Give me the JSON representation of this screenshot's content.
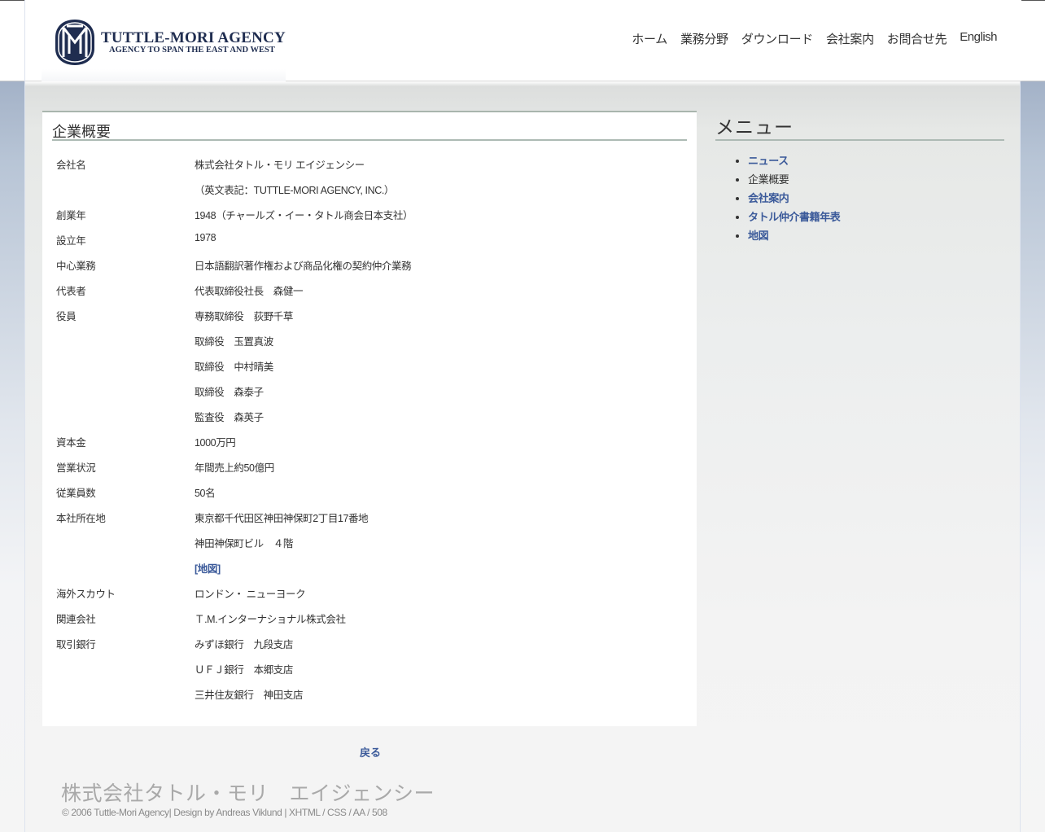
{
  "header": {
    "logo_title": "TUTTLE-MORI AGENCY",
    "logo_subtitle": "AGENCY TO SPAN THE EAST AND WEST",
    "nav": [
      "ホーム",
      "業務分野",
      "ダウンロード",
      "会社案内",
      "お問合せ先",
      "English"
    ]
  },
  "main": {
    "section_title": "企業概要",
    "rows": [
      {
        "key": "会社名",
        "value": "株式会社タトル・モリ エイジェンシー"
      },
      {
        "key": "",
        "value": "（英文表記：TUTTLE-MORI AGENCY, INC.）"
      },
      {
        "key": "創業年",
        "value": "1948（チャールズ・イー・タトル商会日本支社）"
      },
      {
        "key": "設立年",
        "value": "1978"
      },
      {
        "key": "中心業務",
        "value": "日本語翻訳著作権および商品化権の契約仲介業務"
      },
      {
        "key": "代表者",
        "value": "代表取締役社長　森健一"
      },
      {
        "key": "役員",
        "value": "専務取締役　荻野千草"
      },
      {
        "key": "",
        "value": "取締役　玉置真波"
      },
      {
        "key": "",
        "value": "取締役　中村晴美"
      },
      {
        "key": "",
        "value": "取締役　森泰子"
      },
      {
        "key": "",
        "value": "監査役　森英子"
      },
      {
        "key": "資本金",
        "value": "1000万円"
      },
      {
        "key": "営業状況",
        "value": "年間売上約50億円"
      },
      {
        "key": "従業員数",
        "value": "50名"
      },
      {
        "key": "本社所在地",
        "value": "東京都千代田区神田神保町2丁目17番地"
      },
      {
        "key": "",
        "value": "神田神保町ビル　４階"
      },
      {
        "key": "",
        "value": "[地図]",
        "link": true
      },
      {
        "key": "海外スカウト",
        "value": "ロンドン・ ニューヨーク"
      },
      {
        "key": "関連会社",
        "value": "Ｔ.M.インターナショナル株式会社"
      },
      {
        "key": "取引銀行",
        "value": "みずほ銀行　九段支店"
      },
      {
        "key": "",
        "value": "ＵＦＪ銀行　本郷支店"
      },
      {
        "key": "",
        "value": "三井住友銀行　神田支店"
      }
    ],
    "back_label": "戻る"
  },
  "sidebar": {
    "title": "メニュー",
    "items": [
      {
        "label": "ニュース",
        "link": true
      },
      {
        "label": "企業概要",
        "link": false
      },
      {
        "label": "会社案内",
        "link": true
      },
      {
        "label": "タトル仲介書籍年表",
        "link": true
      },
      {
        "label": "地図",
        "link": true
      }
    ]
  },
  "footer": {
    "company_name": "株式会社タトル・モリ　エイジェンシー",
    "copyright": "© 2006 Tuttle-Mori Agency| Design by Andreas Viklund | XHTML / CSS / AA / 508"
  },
  "colors": {
    "accent_link": "#3b5a9a",
    "logo_navy": "#1f2d50",
    "rule": "#adbab4"
  },
  "icons": [
    "tuttle-mori-emblem-icon"
  ]
}
